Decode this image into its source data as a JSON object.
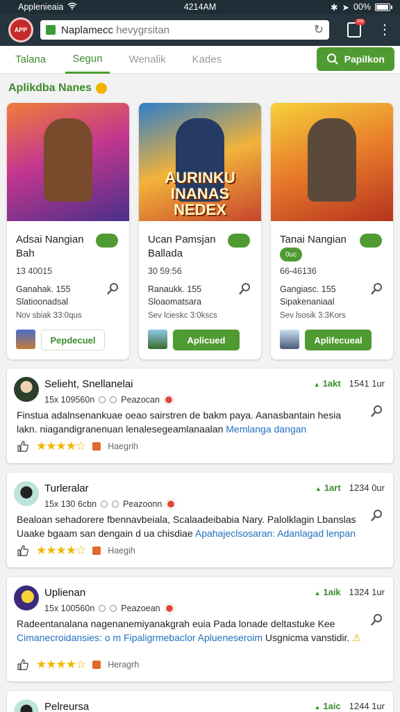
{
  "status_bar": {
    "carrier": "Applenieaia",
    "time": "4214AM",
    "battery": "00%",
    "battery_level": 0.95
  },
  "browser": {
    "logo_text": "APP",
    "url_main": "Naplamecc",
    "url_rest": " hevygrsitan",
    "tab_badge": "P9"
  },
  "tabs": [
    {
      "label": "Talana",
      "state": "green"
    },
    {
      "label": "Segun",
      "state": "active"
    },
    {
      "label": "Wenalik",
      "state": ""
    },
    {
      "label": "Kades",
      "state": ""
    }
  ],
  "search_button": {
    "label": "Papilkon"
  },
  "section": {
    "title": "Aplikdba Nanes"
  },
  "apps": [
    {
      "title": "Adsai Nangian Bah",
      "pill": "",
      "size": "13 40015",
      "meta1": "Ganahak. 155",
      "meta2": "Slatioonadsal",
      "date": "Nov sbiak 33:0qus",
      "action": "Pepdecuel",
      "action_style": "outline",
      "banner": "b1",
      "banner_text": "",
      "thumb": "t1"
    },
    {
      "title": "Ucan Pamsjan Ballada",
      "pill": "",
      "size": "30 59:56",
      "meta1": "Ranaukk. 155",
      "meta2": "Sloaomatsara",
      "date": "Sev lcieskc 3:0kscs",
      "action": "Aplicued",
      "action_style": "filled",
      "banner": "b2",
      "banner_text": "AURINKU INANAS NEDEX",
      "thumb": "t2"
    },
    {
      "title": "Tanai Nangian",
      "pill": "0uc",
      "size": "66-46136",
      "meta1": "Gangiasc. 155",
      "meta2": "Sipakenaniaal",
      "date": "Sev lsosik 3:3Kors",
      "action": "Aplifecueal",
      "action_style": "filled",
      "banner": "b3",
      "banner_text": "",
      "thumb": "t3"
    }
  ],
  "reviews": [
    {
      "name": "Selieht, Snellanelai",
      "stats": "15x 109560n",
      "extra": "Peazocan",
      "votes": "1akt",
      "time": "1541 1ur",
      "text": "Finstua adalnsenankuae oeao sairstren de bakm paya. Aanasbantain hesia lakn. niagandigranenuan lenalesegeamlanaalan ",
      "link": "Memlanga dangan",
      "tail": "",
      "stars": "★★★★☆",
      "footer": "Haegrih",
      "avatar": "av1",
      "size": "r1"
    },
    {
      "name": "Turleralar",
      "stats": "15x 130 6cbn",
      "extra": "Peazoonn",
      "votes": "1art",
      "time": "1234 0ur",
      "text": "Bealoan sehadorere fbennavbeiala, Scalaadeibabia Nary. Palolklagin Lbanslas Uaake bgaam san dengain d ua chisdiae ",
      "link": "Apahajeclsosaran: Adanlagad lenpan",
      "tail": "",
      "stars": "★★★★☆",
      "footer": "Haegih",
      "avatar": "av2",
      "size": "r2"
    },
    {
      "name": "Uplienan",
      "stats": "15x 100560n",
      "extra": "Peazoean",
      "votes": "1aik",
      "time": "1324 1ur",
      "text": "Radeentanalana nagenanemiyanakgrah euia Pada lonade deltastuke Kee ",
      "link": "Cimanecroidansies: o m Fipaligrmebaclor Aplueneseroim",
      "tail": " Usgnicma vanstidir.",
      "stars": "★★★★☆",
      "footer": "Heragrh",
      "avatar": "av1",
      "size": "r3"
    },
    {
      "name": "Pelreursa",
      "stats": "",
      "extra": "",
      "votes": "1aic",
      "time": "1244 1ur",
      "text": "",
      "link": "",
      "tail": "",
      "stars": "",
      "footer": "",
      "avatar": "av2",
      "size": "r4"
    }
  ]
}
